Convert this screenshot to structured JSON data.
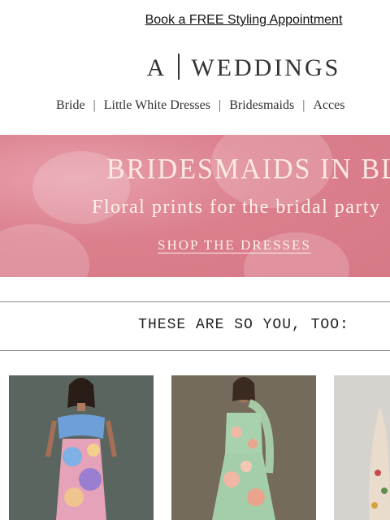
{
  "promo": {
    "link_text": "Book a FREE Styling Appointment"
  },
  "brand": {
    "left": "A",
    "right": "WEDDINGS"
  },
  "nav": {
    "items": [
      "Bride",
      "Little White Dresses",
      "Bridesmaids",
      "Acces"
    ],
    "divider": "|"
  },
  "hero": {
    "title": "BRIDESMAIDS IN BLOOM",
    "subtitle": "Floral prints for the bridal party",
    "cta": "SHOP THE DRESSES"
  },
  "recommendations": {
    "title": "THESE ARE SO YOU, TOO:"
  },
  "colors": {
    "hero_bg": "#db7f8d",
    "hero_text": "#fde9e3",
    "text": "#222222"
  }
}
